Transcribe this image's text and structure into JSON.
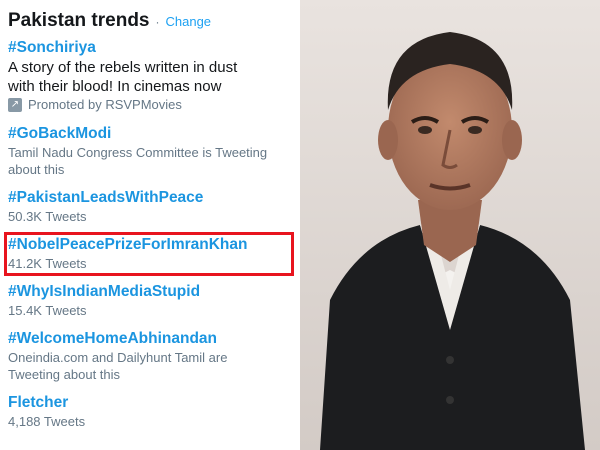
{
  "trends_panel": {
    "title": "Pakistan trends",
    "separator": "·",
    "change_label": "Change",
    "items": [
      {
        "hashtag": "#Sonchiriya",
        "line1": "A story of the rebels written in dust",
        "line2": "with their blood! In cinemas now",
        "promoted": "Promoted by RSVPMovies"
      },
      {
        "hashtag": "#GoBackModi",
        "line1": "Tamil Nadu Congress Committee is Tweeting",
        "line2": "about this"
      },
      {
        "hashtag": "#PakistanLeadsWithPeace",
        "line1": "50.3K Tweets"
      },
      {
        "hashtag": "#NobelPeacePrizeForImranKhan",
        "line1": "41.2K Tweets",
        "highlighted": true
      },
      {
        "hashtag": "#WhyIsIndianMediaStupid",
        "line1": "15.4K Tweets"
      },
      {
        "hashtag": "#WelcomeHomeAbhinandan",
        "line1": "Oneindia.com and Dailyhunt Tamil are",
        "line2": "Tweeting about this"
      },
      {
        "hashtag": "Fletcher",
        "line1": "4,188 Tweets"
      }
    ]
  },
  "colors": {
    "link": "#1b95e0",
    "highlight_border": "#e8141e",
    "muted_text": "#657786"
  }
}
